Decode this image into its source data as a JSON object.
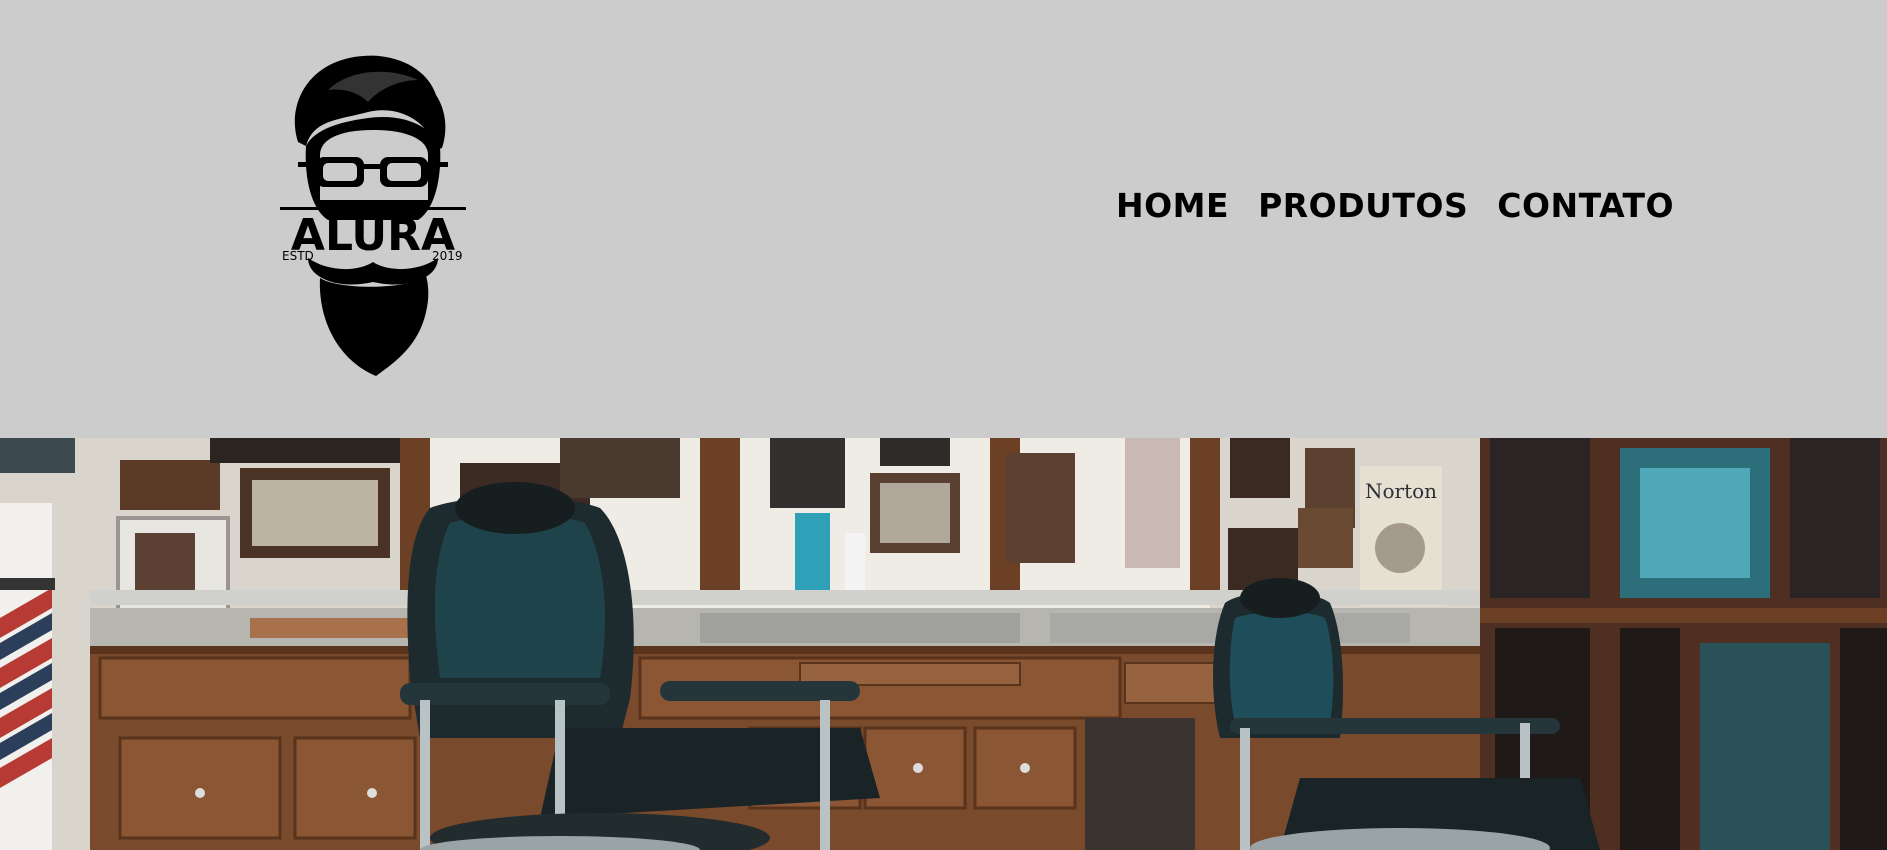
{
  "header": {
    "logo": {
      "icon": "bearded-man-logo",
      "brand": "ALURA",
      "estd_label": "ESTD",
      "year": "2019"
    },
    "nav": [
      {
        "label": "HOME"
      },
      {
        "label": "PRODUTOS"
      },
      {
        "label": "CONTATO"
      }
    ]
  },
  "hero": {
    "image": "barbershop-interior-photo",
    "poster_text": "Norton",
    "colors": {
      "background": "#cccccc",
      "wood": "#7a4a2c",
      "chair_leather": "#1d3a40",
      "teal_accent": "#2ea1b8"
    }
  }
}
